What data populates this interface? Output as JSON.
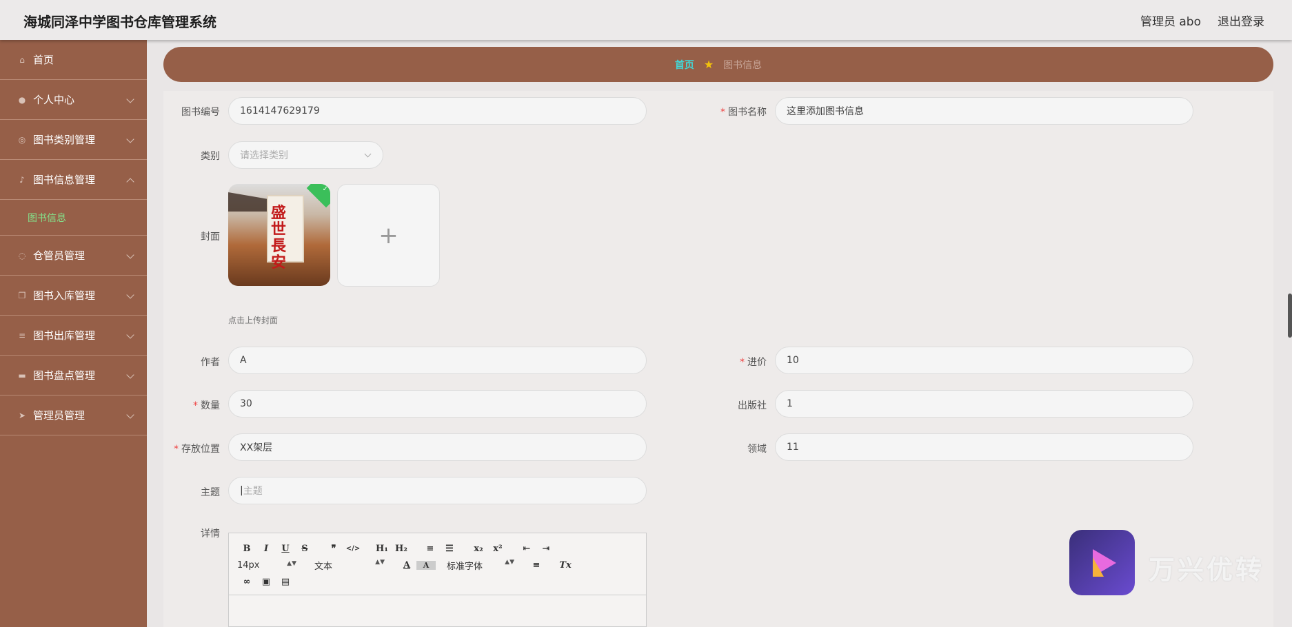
{
  "header": {
    "title": "海城同泽中学图书仓库管理系统",
    "user": "管理员 abo",
    "logout": "退出登录"
  },
  "sidebar": {
    "items": [
      {
        "label": "首页",
        "icon": "home-icon"
      },
      {
        "label": "个人中心",
        "icon": "user-icon"
      },
      {
        "label": "图书类别管理",
        "icon": "category-icon"
      },
      {
        "label": "图书信息管理",
        "icon": "mic-icon"
      },
      {
        "label": "仓管员管理",
        "icon": "circle-icon"
      },
      {
        "label": "图书入库管理",
        "icon": "copy-icon"
      },
      {
        "label": "图书出库管理",
        "icon": "list-icon"
      },
      {
        "label": "图书盘点管理",
        "icon": "monitor-icon"
      },
      {
        "label": "管理员管理",
        "icon": "send-icon"
      }
    ],
    "sub_active": "图书信息"
  },
  "breadcrumb": {
    "home": "首页",
    "current": "图书信息"
  },
  "form": {
    "book_no": {
      "label": "图书编号",
      "value": "1614147629179"
    },
    "book_name": {
      "label": "图书名称",
      "value": "这里添加图书信息"
    },
    "category": {
      "label": "类别",
      "placeholder": "请选择类别"
    },
    "cover": {
      "label": "封面",
      "hint": "点击上传封面",
      "cover_title": "盛世長安"
    },
    "author": {
      "label": "作者",
      "value": "A"
    },
    "price": {
      "label": "进价",
      "value": "10"
    },
    "quantity": {
      "label": "数量",
      "value": "30"
    },
    "publisher": {
      "label": "出版社",
      "value": "1"
    },
    "location": {
      "label": "存放位置",
      "value": "XX架层"
    },
    "field": {
      "label": "领域",
      "value": "11"
    },
    "subject": {
      "label": "主题",
      "placeholder": "主题"
    },
    "details": {
      "label": "详情"
    }
  },
  "editor": {
    "row1": [
      "B",
      "I",
      "U",
      "S",
      "❞",
      "</>",
      "H₁",
      "H₂",
      "≡",
      "☰",
      "x₂",
      "x²",
      "⇤",
      "⇥"
    ],
    "font_size": "14px",
    "text_style": "文本",
    "font_family": "标准字体",
    "clear_format": "Tx"
  },
  "watermark": {
    "text": "万兴优转"
  }
}
